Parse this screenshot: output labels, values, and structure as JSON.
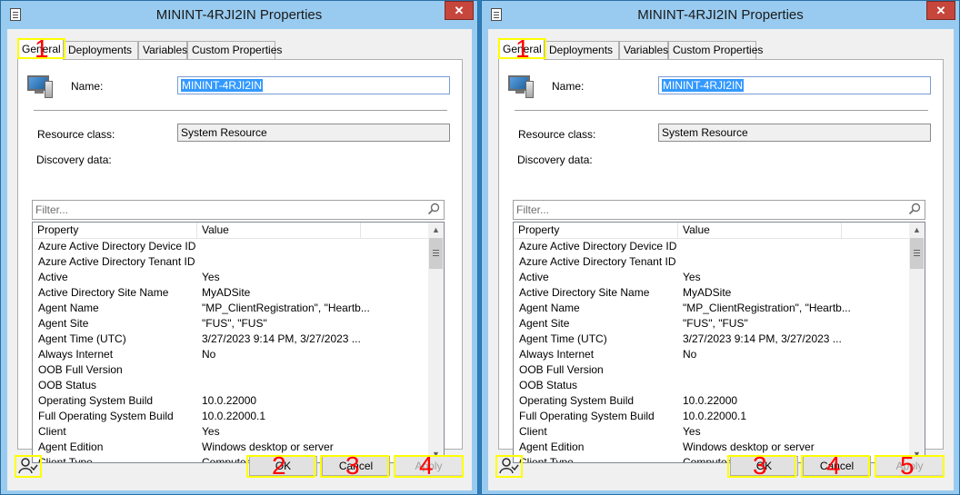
{
  "dialogs": [
    {
      "title": "MININT-4RJI2IN Properties",
      "tabs": [
        "General",
        "Deployments",
        "Variables",
        "Custom Properties"
      ],
      "name_label": "Name:",
      "name_value": "MININT-4RJI2IN",
      "resource_class_label": "Resource class:",
      "resource_class_value": "System Resource",
      "discovery_label": "Discovery data:",
      "filter_placeholder": "Filter...",
      "columns": [
        "Property",
        "Value"
      ],
      "rows": [
        [
          "Azure Active Directory Device ID",
          ""
        ],
        [
          "Azure Active Directory Tenant ID",
          ""
        ],
        [
          "Active",
          "Yes"
        ],
        [
          "Active Directory Site Name",
          "MyADSite"
        ],
        [
          "Agent Name",
          "\"MP_ClientRegistration\", \"Heartb..."
        ],
        [
          "Agent Site",
          "\"FUS\", \"FUS\""
        ],
        [
          "Agent Time (UTC)",
          "3/27/2023 9:14 PM, 3/27/2023 ..."
        ],
        [
          "Always Internet",
          "No"
        ],
        [
          "OOB Full Version",
          ""
        ],
        [
          "OOB Status",
          ""
        ],
        [
          "Operating System Build",
          "10.0.22000"
        ],
        [
          "Full Operating System Build",
          "10.0.22000.1"
        ],
        [
          "Client",
          "Yes"
        ],
        [
          "Agent Edition",
          "Windows desktop or server"
        ],
        [
          "Client Type",
          "Computer"
        ]
      ],
      "buttons": {
        "ok": "OK",
        "cancel": "Cancel",
        "apply": "Apply"
      },
      "markers": [
        "1",
        "2",
        "3",
        "4"
      ]
    },
    {
      "title": "MININT-4RJI2IN Properties",
      "tabs": [
        "General",
        "Deployments",
        "Variables",
        "Custom Properties"
      ],
      "name_label": "Name:",
      "name_value": "MININT-4RJI2IN",
      "resource_class_label": "Resource class:",
      "resource_class_value": "System Resource",
      "discovery_label": "Discovery data:",
      "filter_placeholder": "Filter...",
      "columns": [
        "Property",
        "Value"
      ],
      "rows": [
        [
          "Azure Active Directory Device ID",
          ""
        ],
        [
          "Azure Active Directory Tenant ID",
          ""
        ],
        [
          "Active",
          "Yes"
        ],
        [
          "Active Directory Site Name",
          "MyADSite"
        ],
        [
          "Agent Name",
          "\"MP_ClientRegistration\", \"Heartb..."
        ],
        [
          "Agent Site",
          "\"FUS\", \"FUS\""
        ],
        [
          "Agent Time (UTC)",
          "3/27/2023 9:14 PM, 3/27/2023 ..."
        ],
        [
          "Always Internet",
          "No"
        ],
        [
          "OOB Full Version",
          ""
        ],
        [
          "OOB Status",
          ""
        ],
        [
          "Operating System Build",
          "10.0.22000"
        ],
        [
          "Full Operating System Build",
          "10.0.22000.1"
        ],
        [
          "Client",
          "Yes"
        ],
        [
          "Agent Edition",
          "Windows desktop or server"
        ],
        [
          "Client Type",
          "Computer"
        ]
      ],
      "buttons": {
        "ok": "OK",
        "cancel": "Cancel",
        "apply": "Apply"
      },
      "markers": [
        "1",
        "3",
        "4",
        "5"
      ]
    }
  ],
  "colors": {
    "highlight": "#ffff00",
    "marker": "#ff0000",
    "selection": "#3399ff"
  }
}
